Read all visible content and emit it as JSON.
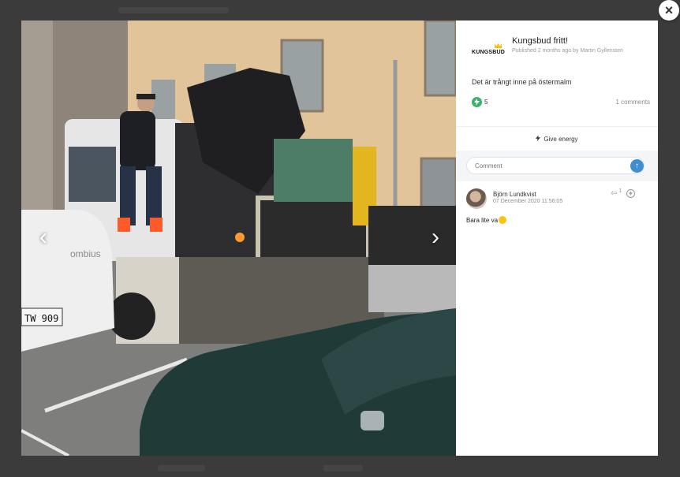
{
  "post": {
    "brand_logo_text": "KUNGSBUD",
    "title": "Kungsbud fritt!",
    "meta": "Published 2 months ago by Martin Gyllensten",
    "body": "Det är trångt inne på östermalm",
    "energy_count": "5",
    "comments_count": "1 comments"
  },
  "actions": {
    "give_energy": "Give energy",
    "comment_placeholder": "Comment",
    "close": "×",
    "prev": "‹",
    "next": "›"
  },
  "comments": [
    {
      "author": "Björn Lundkvist",
      "date": "07 December 2020 11:56:05",
      "text": "Bara lite va",
      "reply_count": "1"
    }
  ],
  "photo": {
    "van_brand": "ombius",
    "plate": "TW 909"
  },
  "colors": {
    "energy_green": "#3db06b",
    "send_blue": "#3e8ed0",
    "backdrop": "#3b3b3b"
  }
}
